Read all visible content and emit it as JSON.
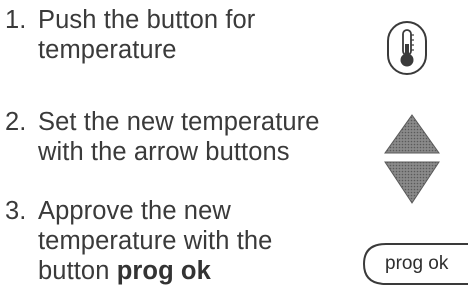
{
  "steps": [
    {
      "number": "1.",
      "lines": [
        "Push the button for",
        "temperature"
      ]
    },
    {
      "number": "2.",
      "lines": [
        "Set the new temperature",
        "with the arrow buttons"
      ]
    },
    {
      "number": "3.",
      "lines": [
        "Approve the new",
        "temperature with the"
      ],
      "last_line_prefix": "button ",
      "last_line_bold": "prog ok"
    }
  ],
  "icons": {
    "step1": "thermometer-button-icon",
    "step2": "up-down-arrows-icon",
    "step3": "prog-ok-button-icon"
  },
  "prog_ok_button_label": "prog ok"
}
